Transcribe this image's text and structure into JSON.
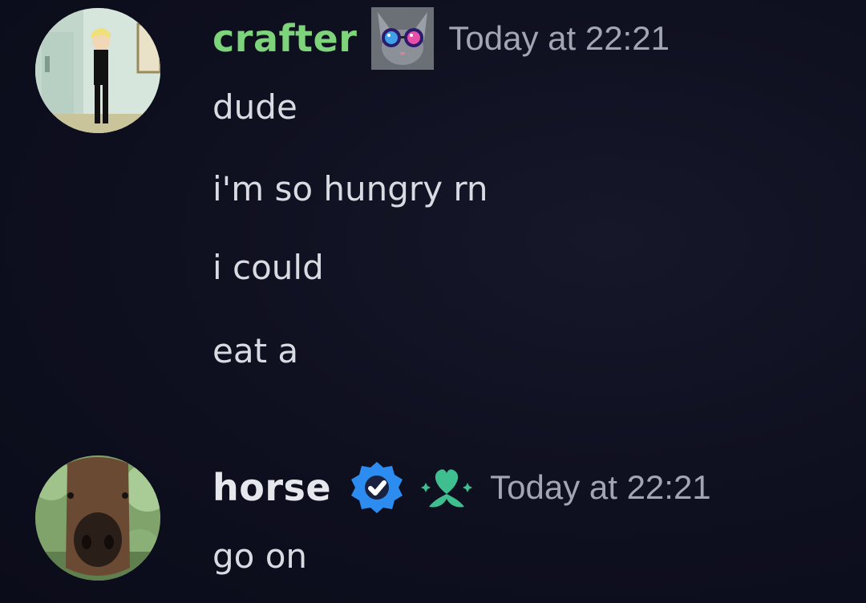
{
  "messages": [
    {
      "author": "crafter",
      "author_color": "#7ed47a",
      "timestamp": "Today at 22:21",
      "badge_icons": [
        "cat-with-galaxy-glasses-badge"
      ],
      "lines": [
        "dude",
        "i'm so hungry rn",
        "i could",
        "eat a"
      ]
    },
    {
      "author": "horse",
      "author_color": "#e6e7ec",
      "timestamp": "Today at 22:21",
      "badge_icons": [
        "verified-check-icon",
        "green-heart-flower-icon"
      ],
      "lines": [
        "go on"
      ]
    }
  ],
  "colors": {
    "background": "#0f1020",
    "text": "#d9dbe2",
    "timestamp": "#a3a6b2",
    "verified_blue": "#2c8cf0",
    "heart_green": "#3fbf8f"
  }
}
